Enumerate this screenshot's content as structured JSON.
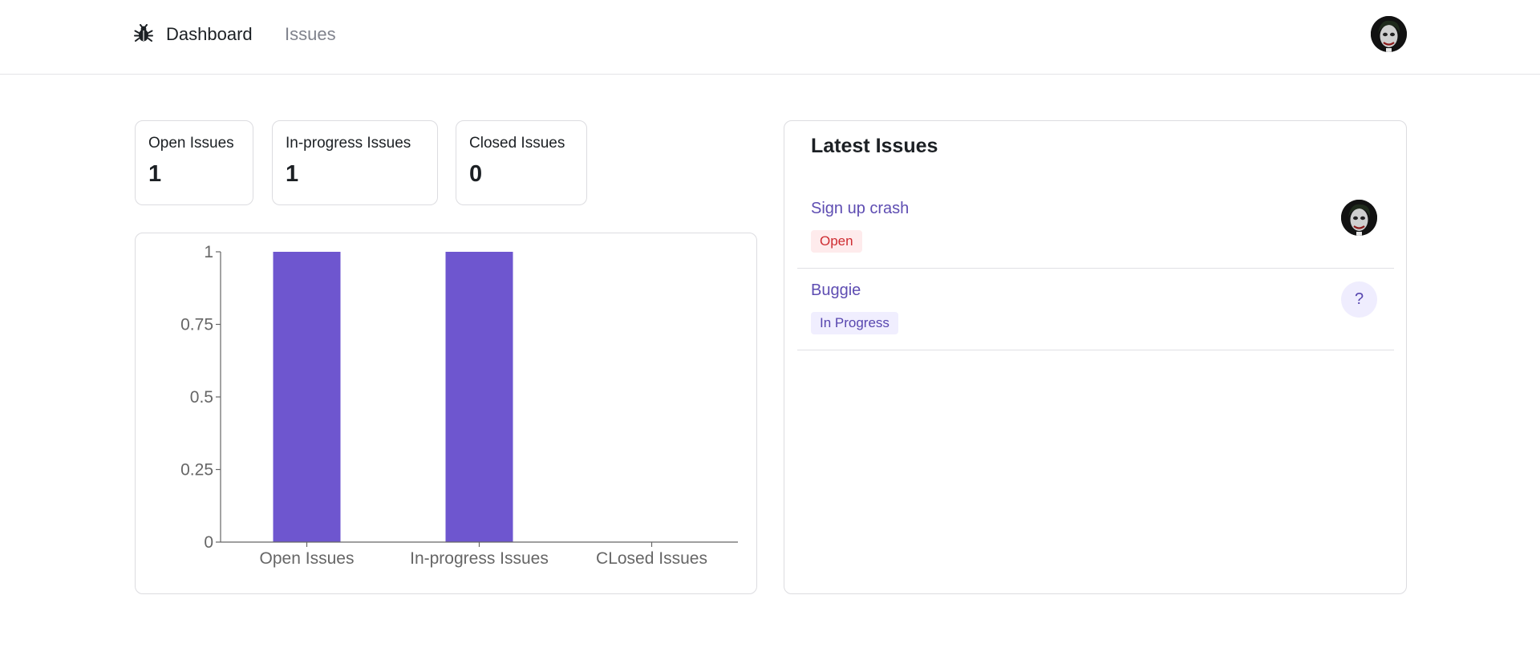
{
  "nav": {
    "links": [
      "Dashboard",
      "Issues"
    ]
  },
  "summary": [
    {
      "label": "Open Issues",
      "value": "1"
    },
    {
      "label": "In-progress Issues",
      "value": "1"
    },
    {
      "label": "Closed Issues",
      "value": "0"
    }
  ],
  "chart_data": {
    "type": "bar",
    "categories": [
      "Open Issues",
      "In-progress Issues",
      "CLosed Issues"
    ],
    "values": [
      1,
      1,
      0
    ],
    "ylim": [
      0,
      1
    ],
    "yticks": [
      0,
      0.25,
      0.5,
      0.75,
      1
    ],
    "bar_color": "#6e56cf",
    "grid": false,
    "title": "",
    "xlabel": "",
    "ylabel": ""
  },
  "latest": {
    "title": "Latest Issues",
    "issues": [
      {
        "title": "Sign up crash",
        "status": "Open",
        "avatar": "user-photo"
      },
      {
        "title": "Buggie",
        "status": "In Progress",
        "avatar_fallback": "?"
      }
    ]
  },
  "colors": {
    "accent": "#6e56cf",
    "open_badge_bg": "#feebec",
    "open_badge_text": "#ce2c31",
    "progress_badge_bg": "#f0eefe",
    "progress_badge_text": "#5746af",
    "border": "#dcdce0"
  },
  "icons": {
    "logo": "bug-icon"
  }
}
